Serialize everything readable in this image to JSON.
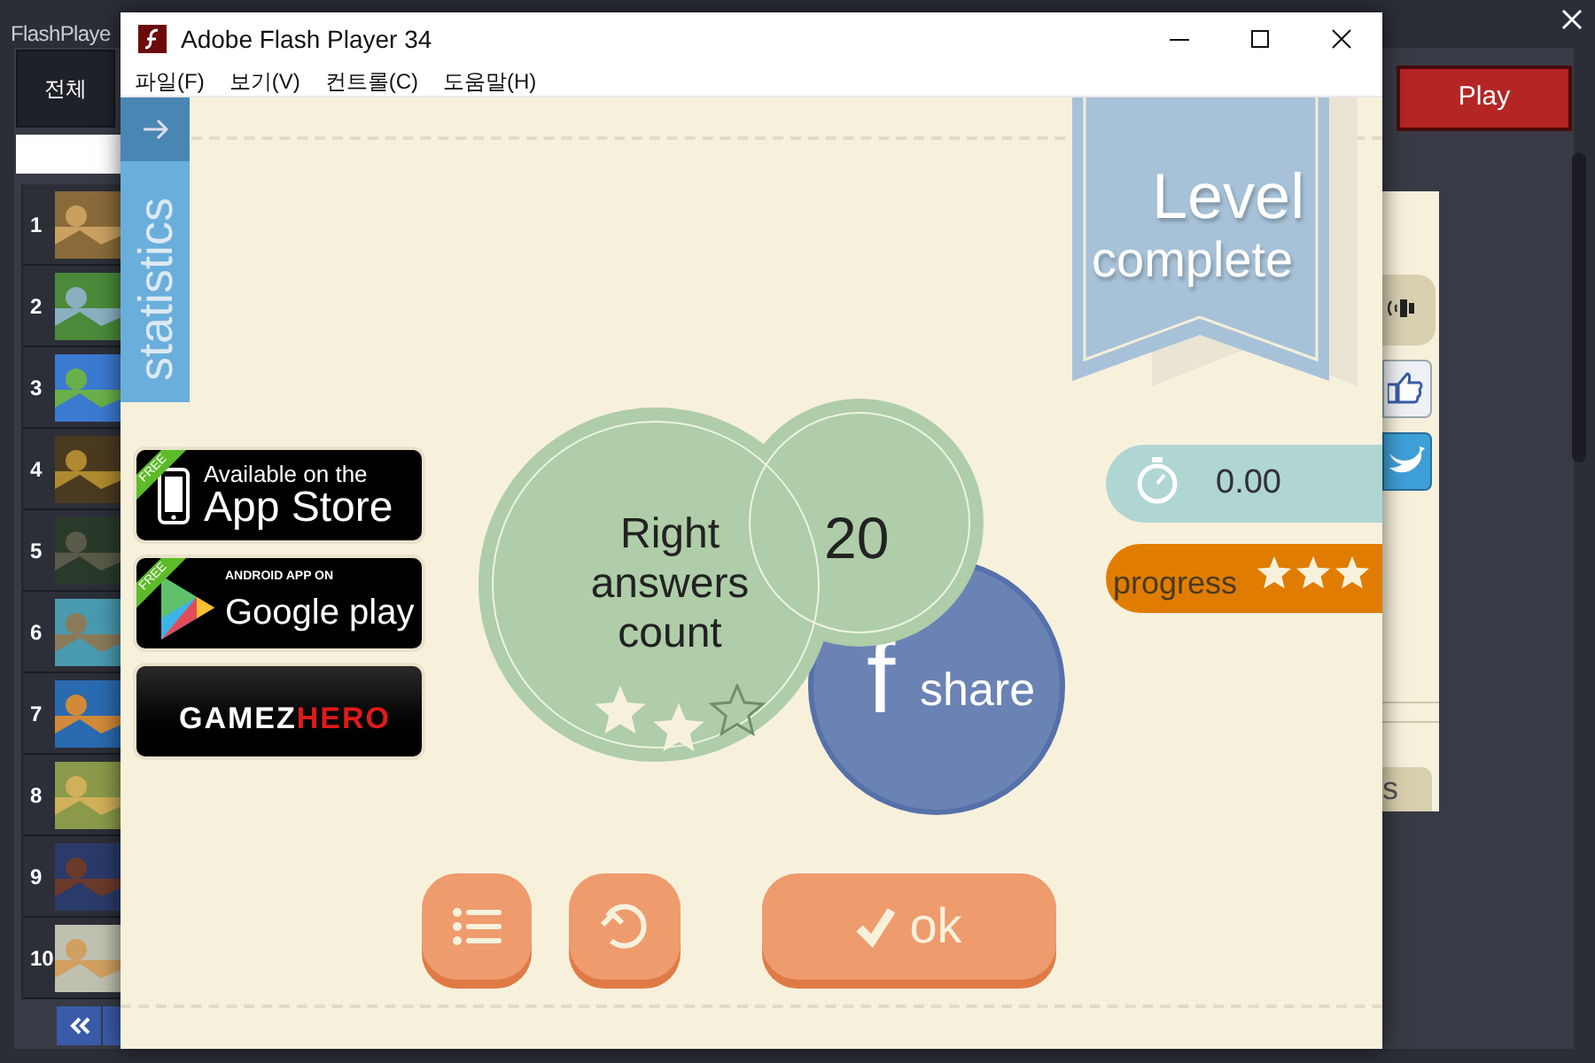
{
  "app": {
    "title": "FlashPlaye",
    "tab": {
      "label": "전체"
    },
    "play_button": "Play"
  },
  "games": [
    {
      "rank": "1",
      "kind": "picture"
    },
    {
      "rank": "2",
      "kind": "picture"
    },
    {
      "rank": "3",
      "kind": "picture"
    },
    {
      "rank": "4",
      "kind": "picture"
    },
    {
      "rank": "5",
      "kind": "picture"
    },
    {
      "rank": "6",
      "kind": "picture"
    },
    {
      "rank": "7",
      "kind": "picture"
    },
    {
      "rank": "8",
      "kind": "picture"
    },
    {
      "rank": "9",
      "kind": "picture"
    },
    {
      "rank": "10",
      "kind": "picture"
    }
  ],
  "background_game": {
    "tab_text": "s"
  },
  "flash_window": {
    "title": "Adobe Flash Player 34",
    "menu": [
      "파일(F)",
      "보기(V)",
      "컨트롤(C)",
      "도움말(H)"
    ]
  },
  "game": {
    "statistics_tab": "statistics",
    "banner": [
      "Level",
      "complete"
    ],
    "store_badges": [
      {
        "kind": "appstore",
        "ribbon": "FREE",
        "line1": "Available on the",
        "line2": "App Store"
      },
      {
        "kind": "googleplay",
        "ribbon": "FREE",
        "line1": "ANDROID APP ON",
        "line2": "Google play"
      },
      {
        "kind": "gamezhero",
        "line1": "GAMEZ",
        "line2": "HERO"
      }
    ],
    "result": {
      "label": [
        "Right",
        "answers",
        "count"
      ],
      "value": "20",
      "stars": 2
    },
    "share": {
      "icon": "f",
      "label": "share"
    },
    "timer": "0.00",
    "progress": {
      "label": "progress",
      "stars": 3
    },
    "ok_button": "ok"
  }
}
